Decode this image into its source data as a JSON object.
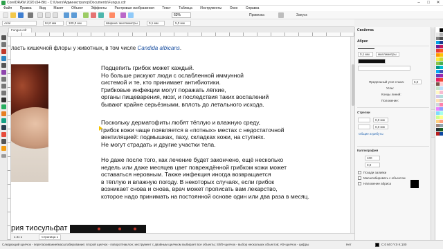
{
  "titlebar": {
    "text": "CorelDRAW 2020 (64-Bit) - C:\\Users\\Администратор\\Documents\\Fungus.cdr",
    "minimize": "–",
    "maximize": "□",
    "close": "✕"
  },
  "menu": [
    "Файл",
    "Правка",
    "Вид",
    "Макет",
    "Объект",
    "Эффекты",
    "Растровые изображения",
    "Текст",
    "Таблица",
    "Инструменты",
    "Окно",
    "Справка"
  ],
  "toolbar": {
    "zoom": "63%",
    "snap": "Привязка",
    "launch": "Запуск"
  },
  "propbar": {
    "font": "Arial",
    "width": "84,0 мм",
    "height": "100,0 мм",
    "outline": "Ширина: миллиметры",
    "outline_width": "0,1 мм",
    "nudge": "5,0 мм"
  },
  "document_tab": "Fungus.cdr",
  "canvas": {
    "intro_line": {
      "prefix": "ласть кишечной флоры у животных, в том числе ",
      "species": "Candida albicans",
      "suffix": "."
    },
    "paragraph1": [
      "Подцепить грибок может каждый.",
      "Но больше рискуют люди с ослабленной иммунной",
      "системой и те, кто принимает антибиотики.",
      "Грибковые инфекции могут поражать лёгкие,",
      "органы пищеварения, мозг, и последствия таких воспалений",
      "бывают крайне серьёзными, вплоть до летального исхода."
    ],
    "paragraph2": [
      "Поскольку дерматофиты любят тёплую и влажную среду,",
      "грибок кожи чаще появляется в «потных» местах с недостаточной",
      "вентиляцией: подмышках, паху, складках кожи, на ступнях.",
      "Не могут страдать и другие участки тела."
    ],
    "paragraph3": [
      "Но даже после того, как лечение будет закончено, ещё несколько",
      "недель или даже месяцев цвет повреждённой грибком кожи может",
      "оставаться неровным. Также инфекция иногда возвращается",
      "в тёплую и влажную погоду. В некоторых случаях, если грибок",
      "возникает снова и снова, врач может прописать вам лекарство,",
      "которое надо принимать на постоянной основе один или два раза в месяц."
    ],
    "bottom_heading": "рия тиосульфат"
  },
  "pagebar": {
    "page_label": "Страница 1",
    "page_counter": "1 из 1"
  },
  "statusbar": {
    "hint": "Следующий щелчок - перетаскивание/масштабирование; второй щелчок - поворот/наклон; инструмент с двойным щелчком выбирает все объекты; Shift+щелчок - выбор нескольких объектов; Alt+щелчок - цифры",
    "fill": "Нет",
    "color_value": "C:0 M:0 Y:0 K:100"
  },
  "docker": {
    "title": "Свойства",
    "section_outline": "Абрис",
    "outline_width": "0,1 мм",
    "outline_units": "миллиметры",
    "miter_label": "Предельный угол стыка:",
    "miter_value": "5,0",
    "corners_label": "Углы:",
    "line_ends_label": "Концы линий:",
    "position_label": "Положение:",
    "section_arrows": "Стрелки",
    "arrow_value1": "0,0 мм",
    "arrow_value2": "0,0 мм",
    "arrow_attrs": "Общие атрибуты",
    "section_calligraphy": "Каллиграфия",
    "calligraphy_stretch": "100",
    "calligraphy_angle": "0,0",
    "chk1": "Позади заливки",
    "chk2": "Масштабировать с объектом",
    "chk3": "Наложение абриса"
  },
  "palette_colors": [
    "#ffffff",
    "#000000",
    "#e6e6e6",
    "#b3b3b3",
    "#808080",
    "#4d4d4d",
    "#00a0e4",
    "#1a3c8f",
    "#6a1b9a",
    "#c2185b",
    "#e53935",
    "#ff5722",
    "#ff9800",
    "#ffc107",
    "#ffeb3b",
    "#cddc39",
    "#8bc34a",
    "#4caf50",
    "#009688",
    "#00bcd4",
    "#03a9f4",
    "#3f51b5",
    "#673ab7",
    "#9c27b0",
    "#e91e63",
    "#f44336",
    "#795548",
    "#ffcdd2",
    "#c8e6c9",
    "#bbdefb",
    "#fff9c4",
    "#f8bbd0",
    "#d1c4e9",
    "#b2dfdb",
    "#ffe0b2",
    "#d7ccc8",
    "#cfd8dc",
    "#ff80ab",
    "#ea80fc",
    "#8c9eff",
    "#80d8ff",
    "#a7ffeb",
    "#ccff90",
    "#ffff8d",
    "#ffd180",
    "#ff9e80",
    "#a1887f",
    "#90a4ae",
    "#263238",
    "#1b5e20",
    "#b71c1c",
    "#0d47a1"
  ]
}
